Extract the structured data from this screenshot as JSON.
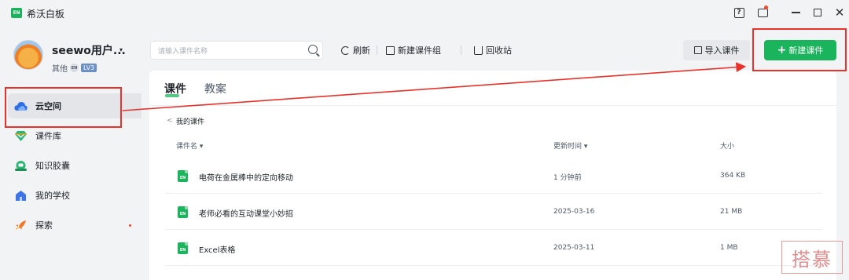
{
  "window": {
    "title": "希沃白板",
    "logo_text": "EN",
    "icons": [
      "help-icon",
      "mail-icon",
      "minimize-icon",
      "maximize-icon",
      "close-icon"
    ],
    "close_glyph": "✕"
  },
  "user": {
    "name": "seewo用户...",
    "caret": "▾",
    "role": "其他",
    "badge_en": "EN",
    "level": "LV3"
  },
  "sidebar": {
    "items": [
      {
        "label": "云空间",
        "icon": "cloud-icon",
        "active": true
      },
      {
        "label": "课件库",
        "icon": "diamond-icon",
        "active": false
      },
      {
        "label": "知识胶囊",
        "icon": "capsule-icon",
        "active": false
      },
      {
        "label": "我的学校",
        "icon": "school-icon",
        "active": false
      },
      {
        "label": "探索",
        "icon": "rocket-icon",
        "active": false,
        "dot": true
      }
    ]
  },
  "toolbar": {
    "search_placeholder": "请输入课件名称",
    "refresh_label": "刷新",
    "new_group_label": "新建课件组",
    "recycle_label": "回收站",
    "import_label": "导入课件",
    "new_label": "新建课件",
    "new_plus": "+"
  },
  "tabs": [
    {
      "label": "课件",
      "active": true
    },
    {
      "label": "教案",
      "active": false
    }
  ],
  "breadcrumb": {
    "arrow": "<",
    "label": "我的课件"
  },
  "table": {
    "headers": {
      "name": "课件名 ▾",
      "updated": "更新时间 ▾",
      "size": "大小"
    },
    "rows": [
      {
        "icon_text": "EN",
        "name": "电荷在金属棒中的定向移动",
        "updated": "1 分钟前",
        "size": "364 KB"
      },
      {
        "icon_text": "EN",
        "name": "老师必看的互动课堂小妙招",
        "updated": "2025-03-16",
        "size": "21 MB"
      },
      {
        "icon_text": "EN",
        "name": "Excel表格",
        "updated": "2025-03-11",
        "size": "1 MB"
      }
    ]
  },
  "annotation": {
    "color": "#e8322b"
  },
  "watermark": {
    "text": "搭慕"
  },
  "colors": {
    "accent": "#19b45b",
    "background": "#f2f3f5",
    "alert_dot": "#f5452f"
  }
}
